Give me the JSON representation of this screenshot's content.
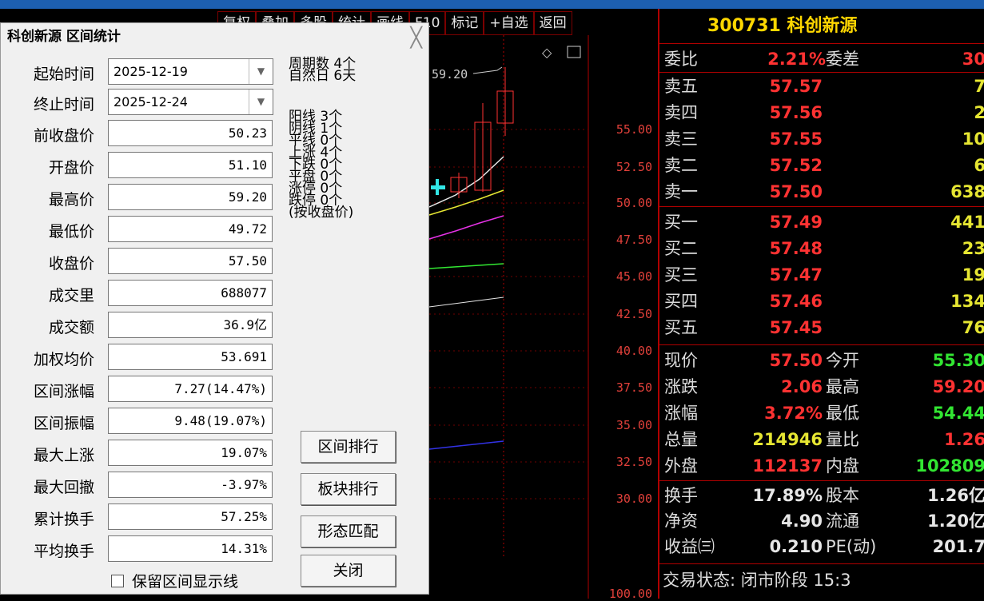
{
  "toolbar": [
    "复权",
    "叠加",
    "多股",
    "统计",
    "画线",
    "F10",
    "标记",
    "+自选",
    "返回"
  ],
  "chart": {
    "peak": "59.20",
    "prices": [
      "55.00",
      "52.50",
      "50.00",
      "47.50",
      "45.00",
      "42.50",
      "40.00",
      "37.50",
      "35.00",
      "32.50",
      "30.00",
      "100.00"
    ]
  },
  "quote": {
    "title": "300731 科创新源",
    "weibi": {
      "l": "委比",
      "v": "2.21%",
      "l2": "委差",
      "v2": "30"
    },
    "sells": [
      {
        "l": "卖五",
        "p": "57.57",
        "q": "7"
      },
      {
        "l": "卖四",
        "p": "57.56",
        "q": "2"
      },
      {
        "l": "卖三",
        "p": "57.55",
        "q": "10"
      },
      {
        "l": "卖二",
        "p": "57.52",
        "q": "6"
      },
      {
        "l": "卖一",
        "p": "57.50",
        "q": "638"
      }
    ],
    "buys": [
      {
        "l": "买一",
        "p": "57.49",
        "q": "441"
      },
      {
        "l": "买二",
        "p": "57.48",
        "q": "23"
      },
      {
        "l": "买三",
        "p": "57.47",
        "q": "19"
      },
      {
        "l": "买四",
        "p": "57.46",
        "q": "134"
      },
      {
        "l": "买五",
        "p": "57.45",
        "q": "76"
      }
    ],
    "stats": [
      {
        "l": "现价",
        "v": "57.50",
        "vc": "red",
        "l2": "今开",
        "v2": "55.30",
        "v2c": "green"
      },
      {
        "l": "涨跌",
        "v": "2.06",
        "vc": "red",
        "l2": "最高",
        "v2": "59.20",
        "v2c": "red"
      },
      {
        "l": "涨幅",
        "v": "3.72%",
        "vc": "red",
        "l2": "最低",
        "v2": "54.44",
        "v2c": "green"
      },
      {
        "l": "总量",
        "v": "214946",
        "vc": "yellow",
        "l2": "量比",
        "v2": "1.26",
        "v2c": "red"
      },
      {
        "l": "外盘",
        "v": "112137",
        "vc": "red",
        "l2": "内盘",
        "v2": "102809",
        "v2c": "green"
      }
    ],
    "stats2": [
      {
        "l": "换手",
        "v": "17.89%",
        "l2": "股本",
        "v2": "1.26亿"
      },
      {
        "l": "净资",
        "v": "4.90",
        "l2": "流通",
        "v2": "1.20亿"
      },
      {
        "l": "收益㈢",
        "v": "0.210",
        "l2": "PE(动)",
        "v2": "201.7"
      }
    ],
    "status": "交易状态: 闭市阶段 15:3"
  },
  "dialog": {
    "title": "科创新源 区间统计",
    "start_label": "起始时间",
    "start": "2025-12-19",
    "end_label": "终止时间",
    "end": "2025-12-24",
    "rows": [
      {
        "l": "前收盘价",
        "v": "50.23"
      },
      {
        "l": "开盘价",
        "v": "51.10"
      },
      {
        "l": "最高价",
        "v": "59.20"
      },
      {
        "l": "最低价",
        "v": "49.72"
      },
      {
        "l": "收盘价",
        "v": "57.50"
      },
      {
        "l": "成交里",
        "v": "688077"
      },
      {
        "l": "成交额",
        "v": "36.9亿"
      },
      {
        "l": "加权均价",
        "v": "53.691"
      },
      {
        "l": "区间涨幅",
        "v": "7.27(14.47%)"
      },
      {
        "l": "区间振幅",
        "v": "9.48(19.07%)"
      },
      {
        "l": "最大上涨",
        "v": "19.07%"
      },
      {
        "l": "最大回撤",
        "v": "-3.97%"
      },
      {
        "l": "累计换手",
        "v": "57.25%"
      },
      {
        "l": "平均换手",
        "v": "14.31%"
      }
    ],
    "info_top": [
      "周期数 4个",
      "自然日 6天"
    ],
    "info": [
      "阳线 3个",
      "阴线 1个",
      "平线 0个",
      "上涨 4个",
      "下跌 0个",
      "平盘 0个",
      "涨停 0个",
      "跌停 0个",
      "(按收盘价)"
    ],
    "buttons": [
      "区间排行",
      "板块排行",
      "形态匹配",
      "关闭"
    ],
    "checkbox": "保留区间显示线"
  }
}
